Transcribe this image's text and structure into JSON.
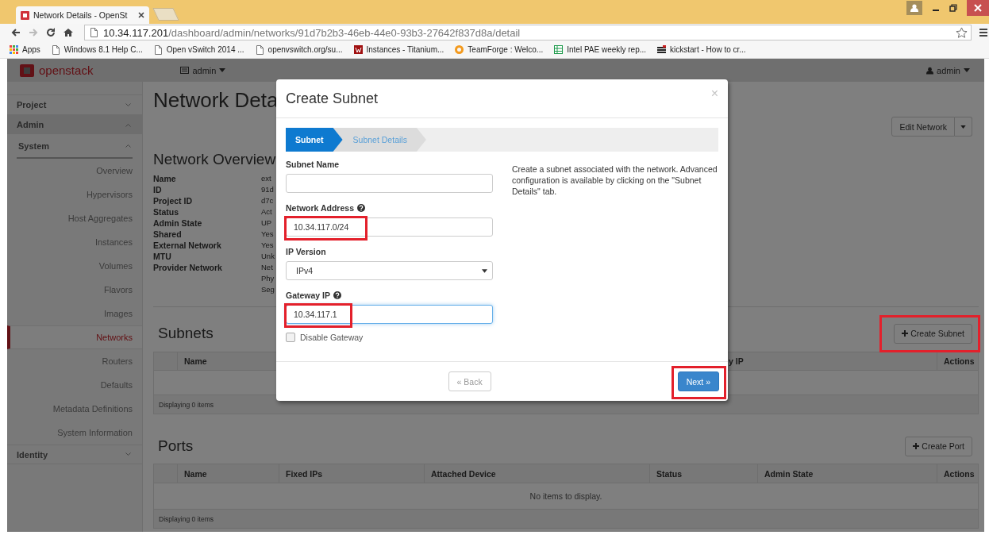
{
  "browser": {
    "tab_title": "Network Details - OpenSt",
    "url_host": "10.34.117.201",
    "url_path": "/dashboard/admin/networks/91d7b2b3-46eb-44e0-93b3-27642f837d8a/detail",
    "bookmarks": [
      {
        "label": "Apps",
        "kind": "apps"
      },
      {
        "label": "Windows 8.1 Help C...",
        "kind": "page"
      },
      {
        "label": "Open vSwitch 2014 ...",
        "kind": "page"
      },
      {
        "label": "openvswitch.org/su...",
        "kind": "page"
      },
      {
        "label": "Instances - Titanium...",
        "kind": "square"
      },
      {
        "label": "TeamForge : Welco...",
        "kind": "ring"
      },
      {
        "label": "Intel PAE weekly rep...",
        "kind": "sheet"
      },
      {
        "label": "kickstart - How to cr...",
        "kind": "bars"
      }
    ]
  },
  "nav": {
    "logo": "openstack",
    "project_menu": "admin",
    "user_menu": "admin"
  },
  "sidebar": {
    "sections": [
      {
        "label": "Project",
        "expanded": false
      },
      {
        "label": "Admin",
        "expanded": true,
        "children": [
          {
            "label": "System",
            "expanded": true,
            "children": [
              {
                "label": "Overview",
                "selected": false
              },
              {
                "label": "Hypervisors",
                "selected": false
              },
              {
                "label": "Host Aggregates",
                "selected": false
              },
              {
                "label": "Instances",
                "selected": false
              },
              {
                "label": "Volumes",
                "selected": false
              },
              {
                "label": "Flavors",
                "selected": false
              },
              {
                "label": "Images",
                "selected": false
              },
              {
                "label": "Networks",
                "selected": true
              },
              {
                "label": "Routers",
                "selected": false
              },
              {
                "label": "Defaults",
                "selected": false
              },
              {
                "label": "Metadata Definitions",
                "selected": false
              },
              {
                "label": "System Information",
                "selected": false
              }
            ]
          }
        ]
      },
      {
        "label": "Identity",
        "expanded": false
      }
    ]
  },
  "page": {
    "title": "Network Deta",
    "edit_button": "Edit Network",
    "overview": {
      "heading": "Network Overview",
      "rows": [
        {
          "label": "Name",
          "values": [
            "ext"
          ]
        },
        {
          "label": "ID",
          "values": [
            "91d"
          ]
        },
        {
          "label": "Project ID",
          "values": [
            "d7c"
          ]
        },
        {
          "label": "Status",
          "values": [
            "Act"
          ]
        },
        {
          "label": "Admin State",
          "values": [
            "UP"
          ]
        },
        {
          "label": "Shared",
          "values": [
            "Yes"
          ]
        },
        {
          "label": "External Network",
          "values": [
            "Yes"
          ]
        },
        {
          "label": "MTU",
          "values": [
            "Unk"
          ]
        },
        {
          "label": "Provider Network",
          "values": [
            "Net",
            "Phy",
            "Seg"
          ]
        }
      ]
    },
    "subnets": {
      "heading": "Subnets",
      "create_button": {
        "label": "Create Subnet",
        "highlighted": true
      },
      "columns": [
        {
          "label": "Name"
        },
        {
          "label": "y IP"
        },
        {
          "label": "Actions"
        }
      ],
      "footer": "Displaying 0 items"
    },
    "ports": {
      "heading": "Ports",
      "create_button": {
        "label": "Create Port",
        "highlighted": false
      },
      "columns": [
        {
          "label": "Name"
        },
        {
          "label": "Fixed IPs"
        },
        {
          "label": "Attached Device"
        },
        {
          "label": "Status"
        },
        {
          "label": "Admin State"
        },
        {
          "label": "Actions"
        }
      ],
      "empty_text": "No items to display.",
      "footer": "Displaying 0 items"
    }
  },
  "modal": {
    "title": "Create Subnet",
    "close": "×",
    "steps": [
      {
        "label": "Subnet",
        "selected": true
      },
      {
        "label": "Subnet Details",
        "selected": false
      }
    ],
    "fields": [
      {
        "kind": "text",
        "label": "Subnet Name",
        "help": false,
        "focused": false,
        "highlighted": false
      },
      {
        "kind": "text",
        "label": "Network Address",
        "help": true,
        "value": "10.34.117.0/24",
        "focused": false,
        "highlighted": true
      },
      {
        "kind": "select",
        "label": "IP Version",
        "help": false,
        "value": "IPv4"
      },
      {
        "kind": "text",
        "label": "Gateway IP",
        "help": true,
        "value": "10.34.117.1",
        "focused": true,
        "highlighted": true
      },
      {
        "kind": "checkbox",
        "label": "Disable Gateway",
        "checked": false
      }
    ],
    "description": "Create a subnet associated with the network. Advanced configuration is available by clicking on the \"Subnet Details\" tab.",
    "buttons": [
      {
        "kind": "back",
        "label": "« Back",
        "highlighted": false
      },
      {
        "kind": "primary",
        "label": "Next »",
        "highlighted": true
      }
    ]
  }
}
